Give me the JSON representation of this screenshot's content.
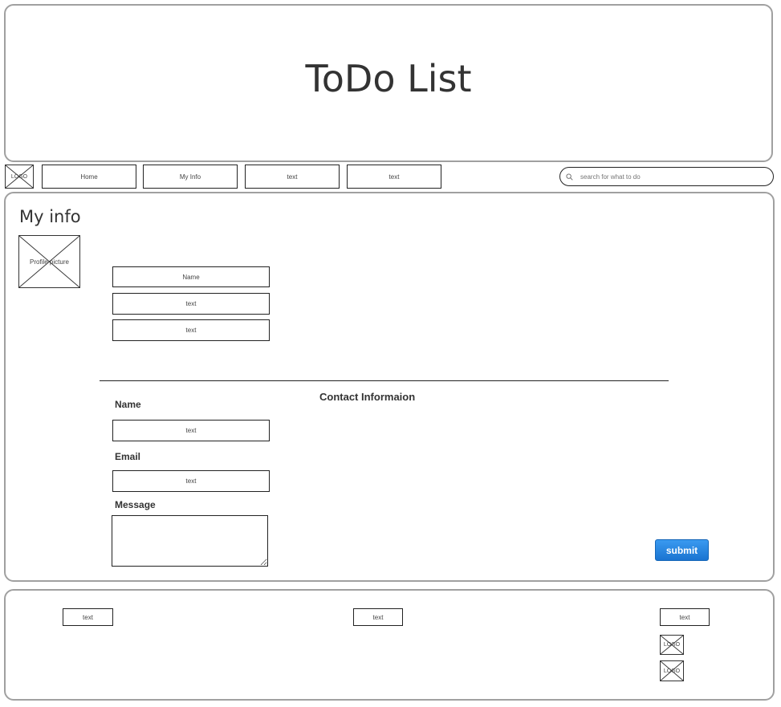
{
  "header": {
    "title": "ToDo List"
  },
  "nav": {
    "logo_label": "LOGO",
    "items": [
      {
        "label": "Home"
      },
      {
        "label": "My Info"
      },
      {
        "label": "text"
      },
      {
        "label": "text"
      }
    ],
    "search": {
      "placeholder": "search for what to do",
      "icon": "search-icon"
    }
  },
  "main": {
    "heading": "My info",
    "profile_picture_label": "Profile picture",
    "info_fields": [
      {
        "label": "Name"
      },
      {
        "label": "text"
      },
      {
        "label": "text"
      }
    ],
    "contact": {
      "heading": "Contact Informaion",
      "name_label": "Name",
      "name_value": "text",
      "email_label": "Email",
      "email_value": "text",
      "message_label": "Message",
      "message_value": "",
      "submit_label": "submit",
      "submit_color": "#1a82e2"
    }
  },
  "footer": {
    "links": [
      {
        "label": "text"
      },
      {
        "label": "text"
      },
      {
        "label": "text"
      }
    ],
    "logos": [
      {
        "label": "LOGO"
      },
      {
        "label": "LOGO"
      }
    ]
  }
}
